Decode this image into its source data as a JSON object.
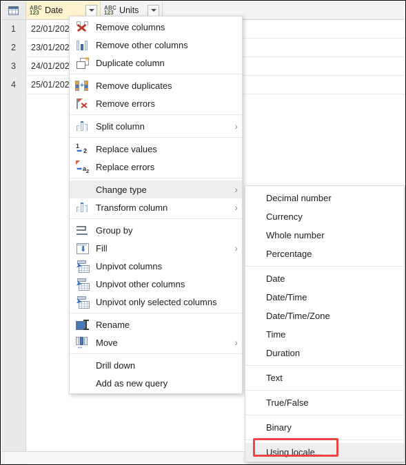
{
  "grid": {
    "corner_icon": "table-select-all-icon",
    "columns": [
      {
        "name": "Date",
        "type_icon": "abc123-icon",
        "selected": true,
        "width": 108
      },
      {
        "name": "Units",
        "type_icon": "abc123-icon",
        "selected": false,
        "width": 90
      }
    ],
    "type_icon_line1": "ABC",
    "type_icon_line2": "123",
    "rows": [
      {
        "num": "1",
        "date": "22/01/202",
        "units": ""
      },
      {
        "num": "2",
        "date": "23/01/202",
        "units": ""
      },
      {
        "num": "3",
        "date": "24/01/202",
        "units": ""
      },
      {
        "num": "4",
        "date": "25/01/202",
        "units": ""
      }
    ]
  },
  "context_menu": {
    "name": "column-context-menu",
    "items": [
      {
        "label": "Remove columns",
        "icon": "remove-columns-icon",
        "submenu": false,
        "highlighted": false
      },
      {
        "label": "Remove other columns",
        "icon": "remove-other-columns-icon",
        "submenu": false,
        "highlighted": false
      },
      {
        "label": "Duplicate column",
        "icon": "duplicate-column-icon",
        "submenu": false,
        "highlighted": false
      },
      {
        "separator": true
      },
      {
        "label": "Remove duplicates",
        "icon": "remove-duplicates-icon",
        "submenu": false,
        "highlighted": false
      },
      {
        "label": "Remove errors",
        "icon": "remove-errors-icon",
        "submenu": false,
        "highlighted": false
      },
      {
        "separator": true
      },
      {
        "label": "Split column",
        "icon": "split-column-icon",
        "submenu": true,
        "highlighted": false
      },
      {
        "separator": true
      },
      {
        "label": "Replace values",
        "icon": "replace-values-icon",
        "submenu": false,
        "highlighted": false
      },
      {
        "label": "Replace errors",
        "icon": "replace-errors-icon",
        "submenu": false,
        "highlighted": false
      },
      {
        "separator": true
      },
      {
        "label": "Change type",
        "icon": "none",
        "submenu": true,
        "highlighted": true
      },
      {
        "label": "Transform column",
        "icon": "transform-column-icon",
        "submenu": true,
        "highlighted": false
      },
      {
        "separator": true
      },
      {
        "label": "Group by",
        "icon": "group-by-icon",
        "submenu": false,
        "highlighted": false
      },
      {
        "label": "Fill",
        "icon": "fill-icon",
        "submenu": true,
        "highlighted": false
      },
      {
        "label": "Unpivot columns",
        "icon": "unpivot-columns-icon",
        "submenu": false,
        "highlighted": false
      },
      {
        "label": "Unpivot other columns",
        "icon": "unpivot-other-columns-icon",
        "submenu": false,
        "highlighted": false
      },
      {
        "label": "Unpivot only selected columns",
        "icon": "unpivot-selected-columns-icon",
        "submenu": false,
        "highlighted": false
      },
      {
        "separator": true
      },
      {
        "label": "Rename",
        "icon": "rename-icon",
        "submenu": false,
        "highlighted": false
      },
      {
        "label": "Move",
        "icon": "move-icon",
        "submenu": true,
        "highlighted": false
      },
      {
        "separator": true
      },
      {
        "label": "Drill down",
        "icon": "none",
        "submenu": false,
        "highlighted": false
      },
      {
        "label": "Add as new query",
        "icon": "none",
        "submenu": false,
        "highlighted": false
      }
    ]
  },
  "change_type_submenu": {
    "name": "change-type-submenu",
    "items": [
      {
        "label": "Decimal number",
        "highlighted": false
      },
      {
        "label": "Currency",
        "highlighted": false
      },
      {
        "label": "Whole number",
        "highlighted": false
      },
      {
        "label": "Percentage",
        "highlighted": false
      },
      {
        "separator": true
      },
      {
        "label": "Date",
        "highlighted": false
      },
      {
        "label": "Date/Time",
        "highlighted": false
      },
      {
        "label": "Date/Time/Zone",
        "highlighted": false
      },
      {
        "label": "Time",
        "highlighted": false
      },
      {
        "label": "Duration",
        "highlighted": false
      },
      {
        "separator": true
      },
      {
        "label": "Text",
        "highlighted": false
      },
      {
        "separator": true
      },
      {
        "label": "True/False",
        "highlighted": false
      },
      {
        "separator": true
      },
      {
        "label": "Binary",
        "highlighted": false
      },
      {
        "separator": true
      },
      {
        "label": "Using locale...",
        "highlighted": true
      }
    ]
  },
  "annotation": {
    "name": "using-locale-highlight",
    "color": "#ef4444",
    "target": "Using locale..."
  },
  "colors": {
    "selected_column_header": "#fdf3cf",
    "menu_highlight": "#eeeeee",
    "annotation_red": "#ef4444"
  }
}
